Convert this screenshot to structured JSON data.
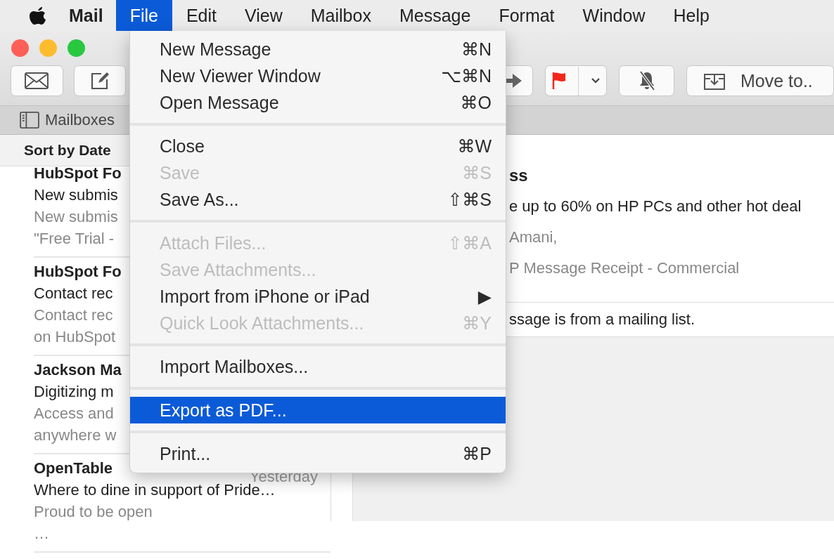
{
  "menu_bar": {
    "app": "Mail",
    "menus": [
      {
        "label": "File",
        "selected": true
      },
      {
        "label": "Edit",
        "selected": false
      },
      {
        "label": "View",
        "selected": false
      },
      {
        "label": "Mailbox",
        "selected": false
      },
      {
        "label": "Message",
        "selected": false
      },
      {
        "label": "Format",
        "selected": false
      },
      {
        "label": "Window",
        "selected": false
      },
      {
        "label": "Help",
        "selected": false
      }
    ]
  },
  "toolbar": {
    "move_button": "Move to.."
  },
  "mailboxes_button": "Mailboxes",
  "sort_label": "Sort by Date",
  "messages": [
    {
      "sender": "HubSpot Fo",
      "subject": "New submis",
      "preview": [
        "New submis",
        "\"Free Trial -"
      ]
    },
    {
      "sender": "HubSpot Fo",
      "subject": "Contact rec",
      "preview": [
        "Contact rec",
        "on HubSpot"
      ]
    },
    {
      "sender": "Jackson Ma",
      "subject": "Digitizing m",
      "preview": [
        "Access and",
        "anywhere w"
      ]
    },
    {
      "sender": "OpenTable",
      "date": "Yesterday",
      "subject": "Where to dine in support of Pride…",
      "preview": [
        "Proud to be open",
        "…"
      ]
    }
  ],
  "detail": {
    "sender": "ss",
    "subject": "e up to 60% on HP PCs and other hot deal",
    "greeting": "Amani,",
    "line": "P Message Receipt - Commercial",
    "notice": "ssage is from a mailing list."
  },
  "file_menu": [
    {
      "kind": "item",
      "label": "New Message",
      "shortcut": "⌘N",
      "disabled": false,
      "selected": false
    },
    {
      "kind": "item",
      "label": "New Viewer Window",
      "shortcut": "⌥⌘N",
      "disabled": false,
      "selected": false
    },
    {
      "kind": "item",
      "label": "Open Message",
      "shortcut": "⌘O",
      "disabled": false,
      "selected": false
    },
    {
      "kind": "separator"
    },
    {
      "kind": "item",
      "label": "Close",
      "shortcut": "⌘W",
      "disabled": false,
      "selected": false
    },
    {
      "kind": "item",
      "label": "Save",
      "shortcut": "⌘S",
      "disabled": true,
      "selected": false
    },
    {
      "kind": "item",
      "label": "Save As...",
      "shortcut": "⇧⌘S",
      "disabled": false,
      "selected": false
    },
    {
      "kind": "separator"
    },
    {
      "kind": "item",
      "label": "Attach Files...",
      "shortcut": "⇧⌘A",
      "disabled": true,
      "selected": false
    },
    {
      "kind": "item",
      "label": "Save Attachments...",
      "disabled": true,
      "selected": false
    },
    {
      "kind": "item",
      "label": "Import from iPhone or iPad",
      "shortcut": "▶",
      "disabled": false,
      "selected": false
    },
    {
      "kind": "item",
      "label": "Quick Look Attachments...",
      "shortcut": "⌘Y",
      "disabled": true,
      "selected": false
    },
    {
      "kind": "separator"
    },
    {
      "kind": "item",
      "label": "Import Mailboxes...",
      "disabled": false,
      "selected": false
    },
    {
      "kind": "separator"
    },
    {
      "kind": "item",
      "label": "Export as PDF...",
      "disabled": false,
      "selected": true
    },
    {
      "kind": "separator"
    },
    {
      "kind": "item",
      "label": "Print...",
      "shortcut": "⌘P",
      "disabled": false,
      "selected": false
    }
  ]
}
